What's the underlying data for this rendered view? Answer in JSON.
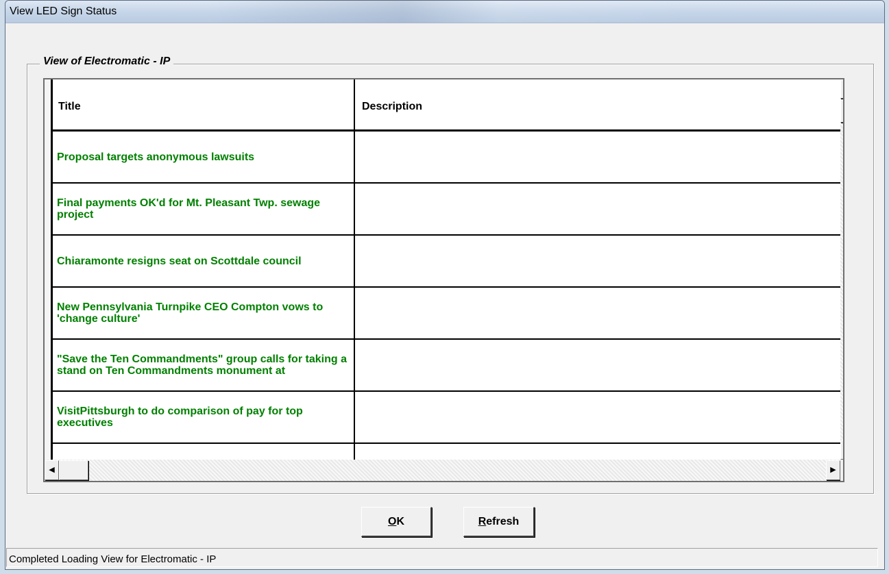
{
  "window": {
    "title": "View LED Sign Status"
  },
  "group": {
    "label": "View of Electromatic - IP"
  },
  "grid": {
    "columns": [
      "Title",
      "Description"
    ],
    "rows": [
      {
        "title": "Proposal targets anonymous lawsuits",
        "description": ""
      },
      {
        "title": "Final payments OK'd for Mt. Pleasant Twp. sewage project",
        "description": ""
      },
      {
        "title": "Chiaramonte resigns seat on Scottdale council",
        "description": ""
      },
      {
        "title": "New Pennsylvania Turnpike CEO Compton vows to 'change culture'",
        "description": ""
      },
      {
        "title": "\"Save the Ten Commandments\" group calls for taking  a stand on Ten Commandments monument at",
        "description": ""
      },
      {
        "title": "VisitPittsburgh to do comparison of pay for top executives",
        "description": ""
      }
    ],
    "title_color": "#008000"
  },
  "buttons": {
    "ok": {
      "mnemonic": "O",
      "rest": "K"
    },
    "refresh": {
      "mnemonic": "R",
      "rest": "efresh"
    }
  },
  "status": {
    "text": "Completed Loading View for Electromatic - IP"
  },
  "icons": {
    "scroll_up": "▲",
    "scroll_down": "▼",
    "scroll_left": "◀",
    "scroll_right": "▶"
  }
}
